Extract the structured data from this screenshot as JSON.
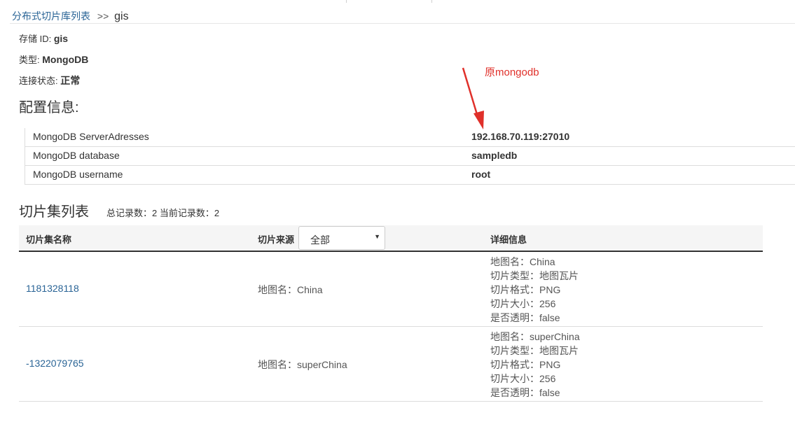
{
  "breadcrumb": {
    "parent": "分布式切片库列表",
    "separator": ">>",
    "current": "gis"
  },
  "storage": {
    "id_label": "存储 ID:",
    "id_value": "gis",
    "type_label": "类型:",
    "type_value": "MongoDB",
    "status_label": "连接状态:",
    "status_value": "正常"
  },
  "config": {
    "title": "配置信息:",
    "rows": [
      {
        "key": "MongoDB ServerAdresses",
        "value": "192.168.70.119:27010"
      },
      {
        "key": "MongoDB database",
        "value": "sampledb"
      },
      {
        "key": "MongoDB username",
        "value": "root"
      }
    ]
  },
  "annotation": {
    "text": "原mongodb",
    "color": "#e0302a"
  },
  "tileset_list": {
    "title": "切片集列表",
    "counts": "总记录数：2  当前记录数：2",
    "headers": {
      "name": "切片集名称",
      "source": "切片来源",
      "detail": "详细信息"
    },
    "source_filter": {
      "selected": "全部",
      "arrow_icon": "caret-down-icon"
    },
    "rows": [
      {
        "id": "1181328118",
        "source": "地图名：China",
        "details": [
          "地图名：China",
          "切片类型：地图瓦片",
          "切片格式：PNG",
          "切片大小：256",
          "是否透明：false"
        ]
      },
      {
        "id": "-1322079765",
        "source": "地图名：superChina",
        "details": [
          "地图名：superChina",
          "切片类型：地图瓦片",
          "切片格式：PNG",
          "切片大小：256",
          "是否透明：false"
        ]
      }
    ]
  },
  "colors": {
    "link": "#2a6496",
    "annotation": "#e0302a",
    "header_bg": "#f5f5f5"
  }
}
